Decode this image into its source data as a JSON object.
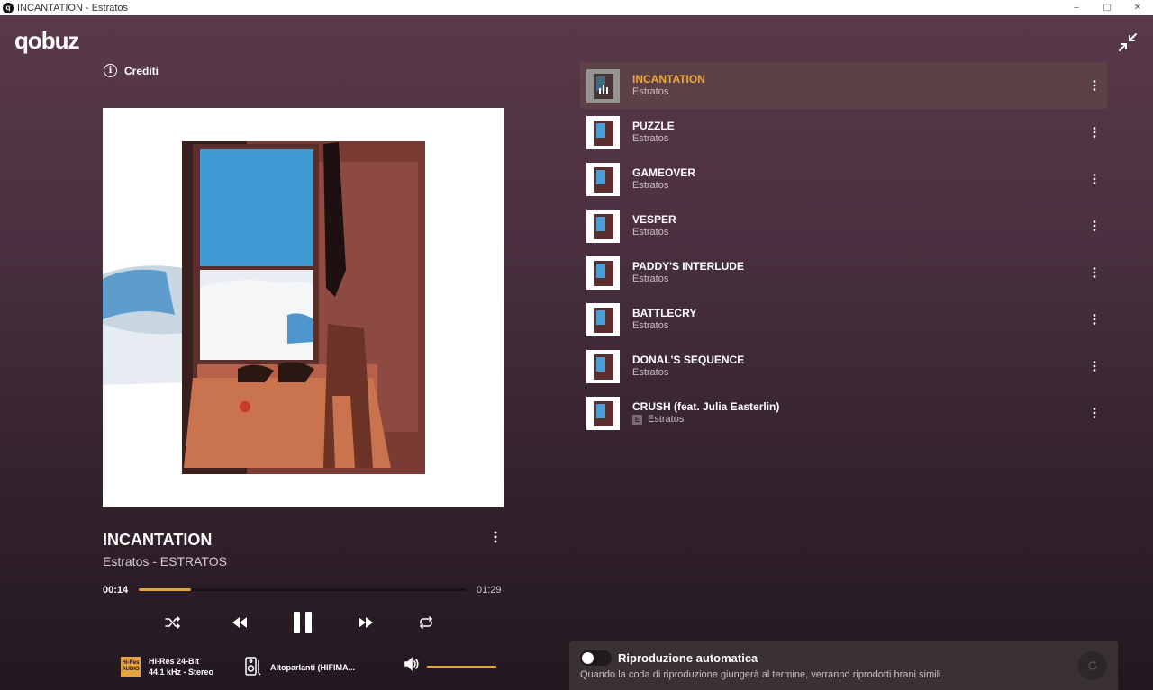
{
  "window": {
    "title": "INCANTATION - Estratos",
    "min": "–",
    "max": "▢",
    "close": "✕"
  },
  "app": {
    "logo": "qobuz"
  },
  "credits": {
    "label": "Crediti",
    "icon": "info-icon"
  },
  "now_playing": {
    "title": "INCANTATION",
    "subtitle": "Estratos - ESTRATOS",
    "current_time": "00:14",
    "total_time": "01:29",
    "progress_fraction": 0.16
  },
  "quality": {
    "badge_top": "Hi-Res",
    "badge_bottom": "AUDIO",
    "line1": "Hi-Res 24-Bit",
    "line2": "44.1 kHz - Stereo"
  },
  "output": {
    "label": "Altoparlanti (HIFIMA..."
  },
  "volume": {
    "level": 1.0
  },
  "queue": [
    {
      "title": "INCANTATION",
      "artist": "Estratos",
      "active": true,
      "explicit": false
    },
    {
      "title": "PUZZLE",
      "artist": "Estratos",
      "active": false,
      "explicit": false
    },
    {
      "title": "GAMEOVER",
      "artist": "Estratos",
      "active": false,
      "explicit": false
    },
    {
      "title": "VESPER",
      "artist": "Estratos",
      "active": false,
      "explicit": false
    },
    {
      "title": "PADDY'S INTERLUDE",
      "artist": "Estratos",
      "active": false,
      "explicit": false
    },
    {
      "title": "BATTLECRY",
      "artist": "Estratos",
      "active": false,
      "explicit": false
    },
    {
      "title": "DONAL'S SEQUENCE",
      "artist": "Estratos",
      "active": false,
      "explicit": false
    },
    {
      "title": "CRUSH (feat. Julia Easterlin)",
      "artist": "Estratos",
      "active": false,
      "explicit": true
    }
  ],
  "explicit_label": "E",
  "autoplay": {
    "title": "Riproduzione automatica",
    "description": "Quando la coda di riproduzione giungerà al termine, verranno riprodotti brani simili.",
    "enabled": false
  },
  "colors": {
    "accent": "#e6a23c",
    "active_row": "#5c4146"
  }
}
